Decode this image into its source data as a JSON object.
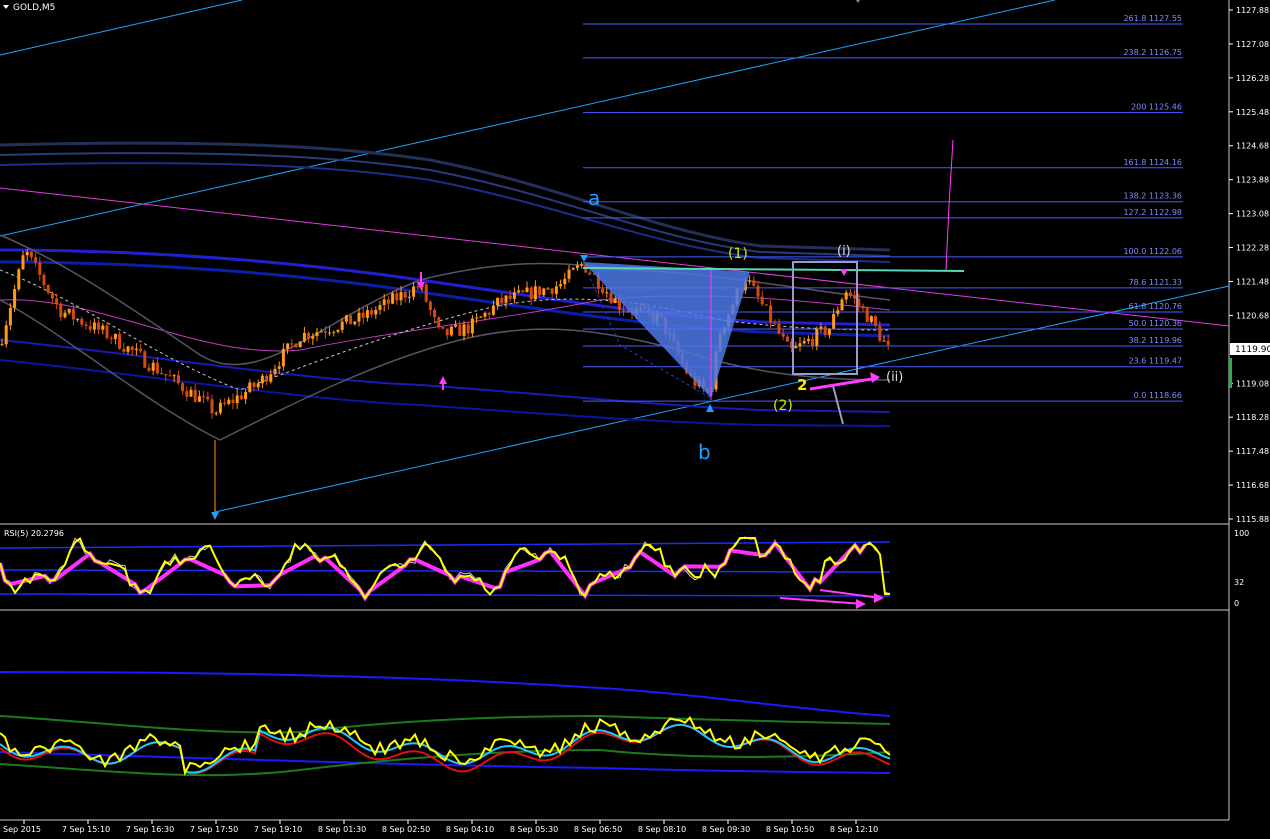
{
  "window": {
    "title": "GOLD,M5",
    "menu_icon": "triangle-down-icon"
  },
  "colors": {
    "background": "#000000",
    "fib": "#4a5bff",
    "fib_text": "#7e8bff",
    "candle_up": "#ff9a1a",
    "candle_down": "#d64a10",
    "axis": "#ffffff",
    "wave_cyan": "#1ea0ff",
    "wave_yellow": "#d2e600",
    "rsi_line": "#ffff00",
    "rsi_pink": "#ff30ff",
    "magenta": "#ff3cff",
    "channel_blue": "#0000ff"
  },
  "price_axis": {
    "ticks": [
      "1127.88",
      "1127.08",
      "1126.28",
      "1125.48",
      "1124.68",
      "1123.88",
      "1123.08",
      "1122.28",
      "1121.48",
      "1120.68",
      "1119.08",
      "1118.28",
      "1117.48",
      "1116.68",
      "1115.88"
    ],
    "current_price": "1119.90"
  },
  "fib_levels": [
    {
      "label": "261.8 1127.55",
      "price": 1127.55
    },
    {
      "label": "238.2 1126.75",
      "price": 1126.75
    },
    {
      "label": "200 1125.46",
      "price": 1125.46
    },
    {
      "label": "161.8 1124.16",
      "price": 1124.16
    },
    {
      "label": "138.2 1123.36",
      "price": 1123.36
    },
    {
      "label": "127.2 1122.98",
      "price": 1122.98
    },
    {
      "label": "100.0 1122.06",
      "price": 1122.06
    },
    {
      "label": "78.6 1121.33",
      "price": 1121.33
    },
    {
      "label": "61.8 1120.76",
      "price": 1120.76
    },
    {
      "label": "50.0 1120.36",
      "price": 1120.36
    },
    {
      "label": "38.2 1119.96",
      "price": 1119.96
    },
    {
      "label": "23.6 1119.47",
      "price": 1119.47
    },
    {
      "label": "0.0 1118.66",
      "price": 1118.66
    }
  ],
  "wave_labels": {
    "a": "a",
    "b": "b",
    "w1": "(1)",
    "w2": "(2)",
    "wi": "(i)",
    "wii": "(ii)",
    "two": "2"
  },
  "rsi": {
    "label": "RSI(5) 20.2796",
    "ticks": [
      "100",
      "32",
      "0"
    ]
  },
  "time_axis": [
    "Sep 2015",
    "7 Sep 15:10",
    "7 Sep 16:30",
    "7 Sep 17:50",
    "7 Sep 19:10",
    "8 Sep 01:30",
    "8 Sep 02:50",
    "8 Sep 04:10",
    "8 Sep 05:30",
    "8 Sep 06:50",
    "8 Sep 08:10",
    "8 Sep 09:30",
    "8 Sep 10:50",
    "8 Sep 12:10"
  ]
}
